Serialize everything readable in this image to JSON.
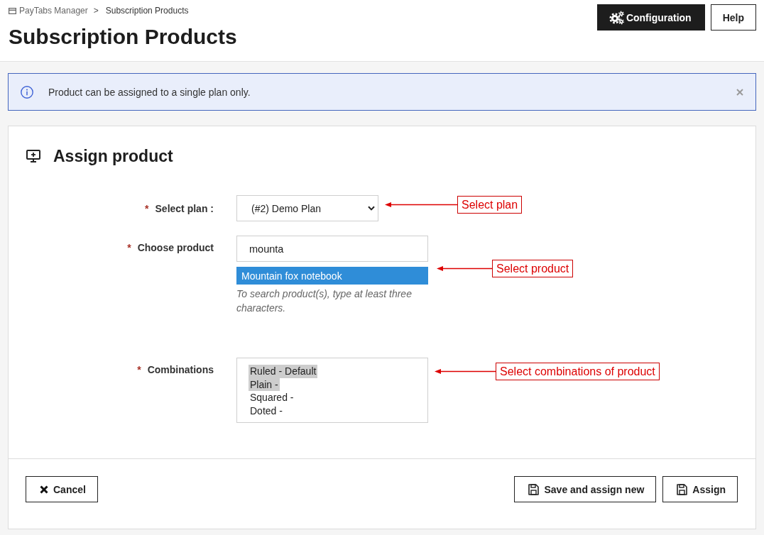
{
  "breadcrumb": {
    "items": [
      {
        "label": "PayTabs Manager",
        "kind": "link"
      },
      {
        "label": "Subscription Products",
        "kind": "current"
      }
    ],
    "separator": ">"
  },
  "page_title": "Subscription Products",
  "header_buttons": [
    {
      "label": "Configuration",
      "kind": "primary"
    },
    {
      "label": "Help",
      "kind": "plain"
    }
  ],
  "alert": {
    "message": "Product can be assigned to a single plan only."
  },
  "panel": {
    "title": "Assign product",
    "fields": [
      {
        "kind": "select",
        "required_mark": "*",
        "label": "Select plan :",
        "value": "(#2) Demo Plan",
        "annotation": "Select plan"
      },
      {
        "kind": "autocomplete",
        "required_mark": "*",
        "label": "Choose product",
        "value": "mounta",
        "suggestions": [
          {
            "label": "Mountain fox notebook",
            "selected": true
          }
        ],
        "help": "To search product(s), type at least three characters.",
        "annotation": "Select product"
      },
      {
        "kind": "multiselect",
        "required_mark": "*",
        "label": "Combinations",
        "options": [
          {
            "label": "Ruled - Default",
            "selected": true
          },
          {
            "label": "Plain -",
            "selected": true
          },
          {
            "label": "Squared -",
            "selected": false
          },
          {
            "label": "Doted -",
            "selected": false
          }
        ],
        "annotation": "Select combinations of product"
      }
    ],
    "buttons": [
      {
        "label": "Cancel",
        "kind": "cancel"
      },
      {
        "label": "Save and assign new",
        "kind": "save_new"
      },
      {
        "label": "Assign",
        "kind": "assign"
      }
    ]
  }
}
